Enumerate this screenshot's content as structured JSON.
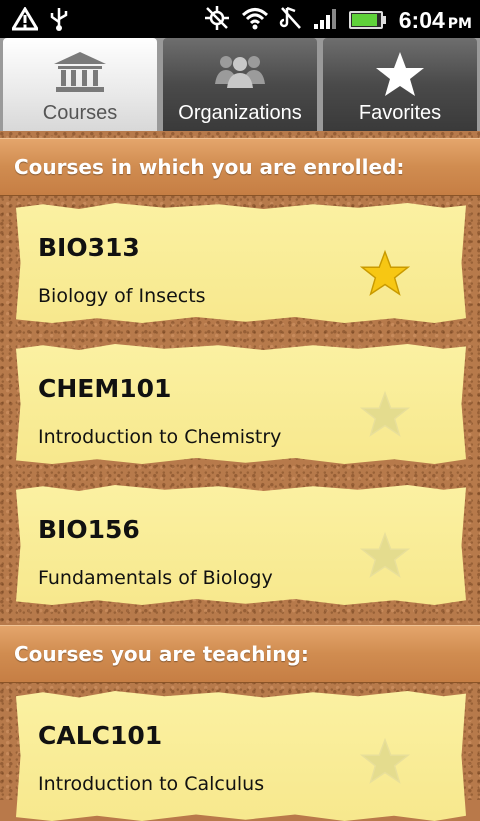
{
  "status_bar": {
    "time": "6:04",
    "ampm": "PM",
    "icons": [
      "warning-icon",
      "usb-icon",
      "no-gps-icon",
      "wifi-icon",
      "vibrate-icon",
      "signal-icon",
      "battery-icon"
    ],
    "battery_level": 0.85
  },
  "tabs": [
    {
      "label": "Courses",
      "icon": "bank-icon",
      "active": true
    },
    {
      "label": "Organizations",
      "icon": "people-icon",
      "active": false
    },
    {
      "label": "Favorites",
      "icon": "star-icon",
      "active": false
    }
  ],
  "sections": {
    "enrolled_title": "Courses in which you are enrolled:",
    "teaching_title": "Courses you are teaching:"
  },
  "courses": [
    {
      "code": "BIO313",
      "name": "Biology of Insects",
      "favorite": true
    },
    {
      "code": "CHEM101",
      "name": "Introduction to Chemistry",
      "favorite": false
    },
    {
      "code": "BIO156",
      "name": "Fundamentals of Biology",
      "favorite": false
    },
    {
      "code": "CALC101",
      "name": "Introduction to Calculus",
      "favorite": false
    }
  ],
  "colors": {
    "star_active": "#f7c713",
    "star_inactive": "#e4dc8e",
    "note": "#f8ec95",
    "cork": "#b77a4b",
    "header": "#d08c50"
  }
}
